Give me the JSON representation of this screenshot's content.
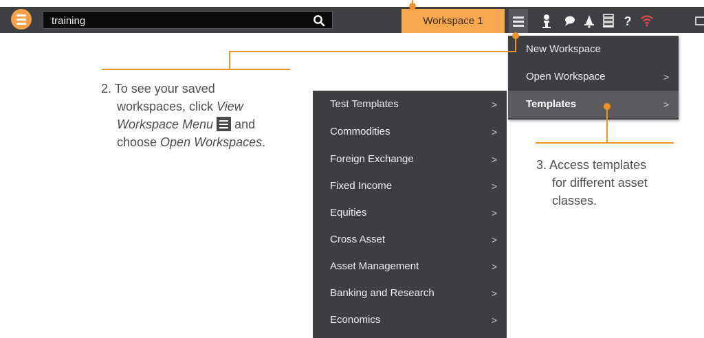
{
  "topbar": {
    "search_value": "training",
    "workspace_tab_label": "Workspace 1",
    "icons": [
      "user-icon",
      "chat-icon",
      "bell-icon",
      "list-icon",
      "help-icon",
      "wifi-icon",
      "window-icon"
    ],
    "accent_color": "#f7a84f"
  },
  "workspace_menu": {
    "items": [
      {
        "label": "New Workspace",
        "has_submenu": false
      },
      {
        "label": "Open Workspace",
        "has_submenu": true
      },
      {
        "label": "Templates",
        "has_submenu": true,
        "active": true
      }
    ],
    "chevron": ">"
  },
  "templates_submenu": {
    "items": [
      {
        "label": "Test Templates"
      },
      {
        "label": "Commodities"
      },
      {
        "label": "Foreign Exchange"
      },
      {
        "label": "Fixed Income"
      },
      {
        "label": "Equities"
      },
      {
        "label": "Cross Asset"
      },
      {
        "label": "Asset Management"
      },
      {
        "label": "Banking and Research"
      },
      {
        "label": "Economics"
      }
    ]
  },
  "callouts": {
    "step2": {
      "prefix": "2. To see your saved",
      "line2_text": "workspaces, click ",
      "line2_em": "View",
      "line3_em": "Workspace Menu",
      "line3_after": " and",
      "line4_before": "choose ",
      "line4_em": "Open Workspaces",
      "line4_after": "."
    },
    "step3": {
      "line1": "3. Access templates",
      "line2": "for different asset",
      "line3": "classes."
    }
  }
}
